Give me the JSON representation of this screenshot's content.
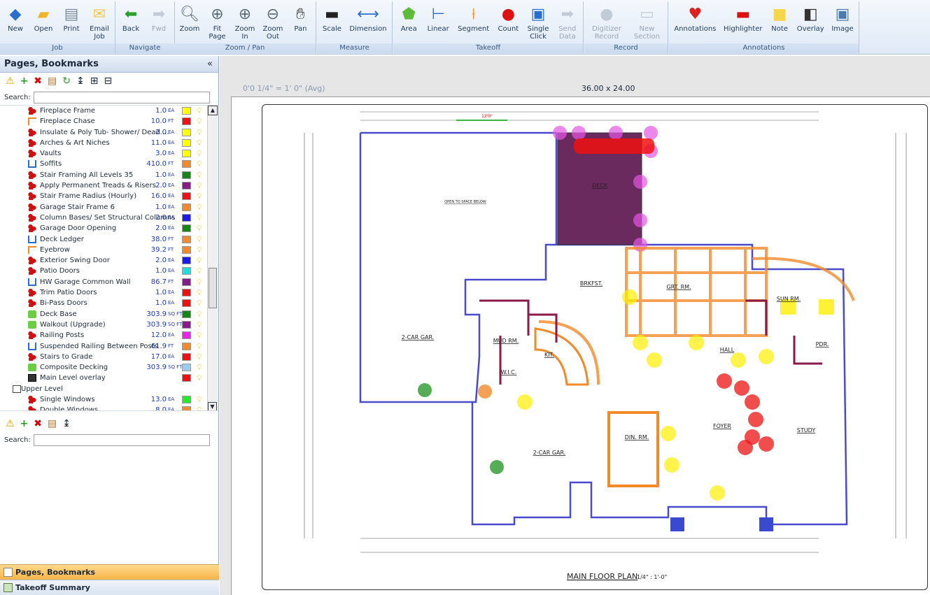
{
  "ribbon": {
    "groups": [
      {
        "label": "Job",
        "buttons": [
          {
            "label": "New",
            "icon": "new-icon"
          },
          {
            "label": "Open",
            "icon": "open-folder-icon"
          },
          {
            "label": "Print",
            "icon": "printer-icon"
          },
          {
            "label": "Email\nJob",
            "icon": "envelope-icon"
          }
        ]
      },
      {
        "label": "Navigate",
        "buttons": [
          {
            "label": "Back",
            "icon": "back-arrow-icon"
          },
          {
            "label": "Fwd",
            "icon": "forward-arrow-icon",
            "disabled": true
          }
        ]
      },
      {
        "label": "Zoom / Pan",
        "buttons": [
          {
            "label": "Zoom",
            "icon": "magnifier-icon"
          },
          {
            "label": "Fit\nPage",
            "icon": "fit-page-icon"
          },
          {
            "label": "Zoom\nIn",
            "icon": "zoom-in-icon"
          },
          {
            "label": "Zoom\nOut",
            "icon": "zoom-out-icon"
          },
          {
            "label": "Pan",
            "icon": "hand-icon"
          }
        ]
      },
      {
        "label": "Measure",
        "buttons": [
          {
            "label": "Scale",
            "icon": "scale-icon"
          },
          {
            "label": "Dimension",
            "icon": "dimension-icon"
          }
        ]
      },
      {
        "label": "Takeoff",
        "buttons": [
          {
            "label": "Area",
            "icon": "area-icon"
          },
          {
            "label": "Linear",
            "icon": "linear-icon"
          },
          {
            "label": "Segment",
            "icon": "segment-icon"
          },
          {
            "label": "Count",
            "icon": "count-icon"
          },
          {
            "label": "Single\nClick",
            "icon": "single-click-icon"
          },
          {
            "label": "Send\nData",
            "icon": "send-data-icon",
            "disabled": true
          }
        ]
      },
      {
        "label": "Record",
        "buttons": [
          {
            "label": "Digitizer\nRecord",
            "icon": "digitizer-icon",
            "disabled": true
          },
          {
            "label": "New\nSection",
            "icon": "new-section-icon",
            "disabled": true
          }
        ]
      },
      {
        "label": "Annotations",
        "buttons": [
          {
            "label": "Annotations",
            "icon": "annotations-icon"
          },
          {
            "label": "Highlighter",
            "icon": "highlighter-icon"
          },
          {
            "label": "Note",
            "icon": "note-icon"
          },
          {
            "label": "Overlay",
            "icon": "overlay-icon"
          },
          {
            "label": "Image",
            "icon": "image-icon"
          }
        ]
      }
    ]
  },
  "left_panel": {
    "title": "Pages, Bookmarks",
    "collapse_label": "«",
    "search_label": "Search:",
    "search_value": "",
    "tree": [
      {
        "icon": "count",
        "name": "Fireplace Frame",
        "qty": "1.0",
        "unit": "EA",
        "color": "#ffff00"
      },
      {
        "icon": "segment",
        "name": "Fireplace Chase",
        "qty": "10.0",
        "unit": "FT",
        "color": "#ee1111"
      },
      {
        "icon": "count",
        "name": "Insulate & Poly Tub- Shower/ Dead ...",
        "qty": "2.0",
        "unit": "EA",
        "color": "#ffff00"
      },
      {
        "icon": "count",
        "name": "Arches & Art Niches",
        "qty": "11.0",
        "unit": "EA",
        "color": "#ffff00"
      },
      {
        "icon": "count",
        "name": "Vaults",
        "qty": "3.0",
        "unit": "EA",
        "color": "#ffff00"
      },
      {
        "icon": "linear",
        "name": "Soffits",
        "qty": "410.0",
        "unit": "FT",
        "color": "#f28a2a"
      },
      {
        "icon": "count",
        "name": "Stair Framing All Levels 35",
        "qty": "1.0",
        "unit": "EA",
        "color": "#118811"
      },
      {
        "icon": "count",
        "name": "Apply Permanent Treads & Risers",
        "qty": "2.0",
        "unit": "EA",
        "color": "#8a1a8a"
      },
      {
        "icon": "count",
        "name": "Stair Frame Radius (Hourly)",
        "qty": "16.0",
        "unit": "EA",
        "color": "#ee1111"
      },
      {
        "icon": "count",
        "name": "Garage Stair Frame 6",
        "qty": "1.0",
        "unit": "EA",
        "color": "#f28a2a"
      },
      {
        "icon": "count",
        "name": "Column Bases/ Set Structural Columns",
        "qty": "2.0",
        "unit": "EA",
        "color": "#1a1aee"
      },
      {
        "icon": "count",
        "name": "Garage Door Opening",
        "qty": "2.0",
        "unit": "EA",
        "color": "#118811"
      },
      {
        "icon": "linear",
        "name": "Deck Ledger",
        "qty": "38.0",
        "unit": "FT",
        "color": "#f28a2a"
      },
      {
        "icon": "segment",
        "name": "Eyebrow",
        "qty": "39.2",
        "unit": "FT",
        "color": "#f28a2a"
      },
      {
        "icon": "count",
        "name": "Exterior Swing Door",
        "qty": "2.0",
        "unit": "EA",
        "color": "#1a1aee"
      },
      {
        "icon": "count",
        "name": "Patio Doors",
        "qty": "1.0",
        "unit": "EA",
        "color": "#22dddd"
      },
      {
        "icon": "linear",
        "name": "HW Garage Common Wall",
        "qty": "86.7",
        "unit": "FT",
        "color": "#8a1a8a"
      },
      {
        "icon": "count",
        "name": "Trim Patio Doors",
        "qty": "1.0",
        "unit": "EA",
        "color": "#ee1111"
      },
      {
        "icon": "count",
        "name": "Bi-Pass Doors",
        "qty": "1.0",
        "unit": "EA",
        "color": "#ee1111"
      },
      {
        "icon": "area",
        "name": "Deck Base",
        "qty": "303.9",
        "unit": "SQ FT",
        "color": "#118811"
      },
      {
        "icon": "area",
        "name": "Walkout (Upgrade)",
        "qty": "303.9",
        "unit": "SQ FT",
        "color": "#8a1a8a"
      },
      {
        "icon": "count",
        "name": "Railing Posts",
        "qty": "12.0",
        "unit": "EA",
        "color": "#ee22ee"
      },
      {
        "icon": "linear",
        "name": "Suspended Railing Between Posts",
        "qty": "61.9",
        "unit": "FT",
        "color": "#f28a2a"
      },
      {
        "icon": "count",
        "name": "Stairs to Grade",
        "qty": "17.0",
        "unit": "EA",
        "color": "#ee1111"
      },
      {
        "icon": "area",
        "name": "Composite Decking",
        "qty": "303.9",
        "unit": "SQ FT",
        "color": "#99ccee"
      },
      {
        "icon": "overlay",
        "name": "Main Level overlay",
        "qty": "",
        "unit": "",
        "color": "#ee1111"
      },
      {
        "icon": "page",
        "name": "Upper Level",
        "qty": "",
        "unit": "",
        "color": "",
        "group": true
      },
      {
        "icon": "count",
        "name": "Single Windows",
        "qty": "13.0",
        "unit": "EA",
        "color": "#22ee22"
      },
      {
        "icon": "count",
        "name": "Double Windows",
        "qty": "8.0",
        "unit": "EA",
        "color": "#f28a2a"
      }
    ],
    "lower_search_label": "Search:",
    "lower_search_value": "",
    "tabs": [
      {
        "label": "Pages, Bookmarks",
        "active": true
      },
      {
        "label": "Takeoff Summary",
        "active": false
      }
    ]
  },
  "canvas": {
    "scale_text": "0'0 1/4\" = 1' 0\" (Avg)",
    "size_text": "36.00 x 24.00",
    "plan": {
      "title": "MAIN FLOOR PLAN",
      "scale": "1/4\" : 1'-0\"",
      "dim_top": "12'0\"",
      "rooms": [
        {
          "label": "DECK"
        },
        {
          "label": "OPEN TO SPACE BELOW"
        },
        {
          "label": "BRKFST."
        },
        {
          "label": "GRT. RM."
        },
        {
          "label": "SUN RM."
        },
        {
          "label": "2-CAR GAR."
        },
        {
          "label": "MUD RM."
        },
        {
          "label": "KIT."
        },
        {
          "label": "HALL"
        },
        {
          "label": "PDR."
        },
        {
          "label": "W.I.C."
        },
        {
          "label": "DIN. RM."
        },
        {
          "label": "FOYER"
        },
        {
          "label": "STUDY"
        },
        {
          "label": "2-CAR GAR."
        }
      ]
    }
  }
}
